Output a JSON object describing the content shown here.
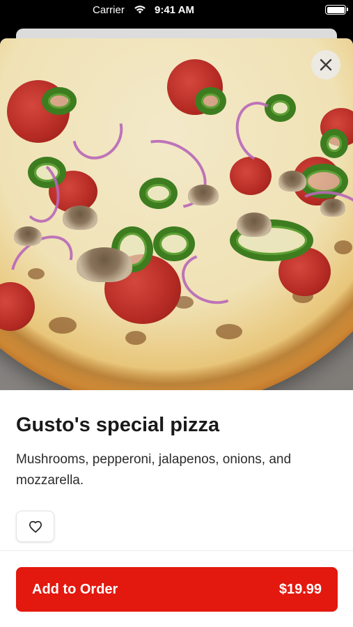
{
  "status_bar": {
    "carrier": "Carrier",
    "time": "9:41 AM"
  },
  "item": {
    "image_icon": "pizza-photo",
    "title": "Gusto's special pizza",
    "description": "Mushrooms, pepperoni, jalapenos, onions, and mozzarella."
  },
  "actions": {
    "close_icon": "close-icon",
    "favorite_icon": "heart-icon",
    "add_label": "Add to Order",
    "price": "$19.99"
  },
  "colors": {
    "accent": "#e3180e"
  }
}
